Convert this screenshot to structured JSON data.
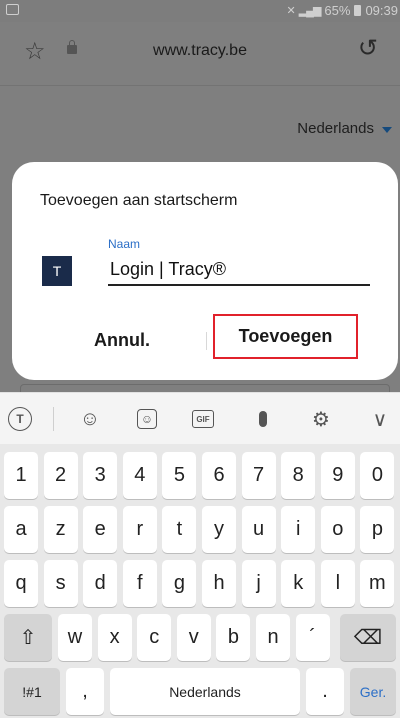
{
  "statusbar": {
    "battery": "65%",
    "time": "09:39"
  },
  "browser": {
    "url": "www.tracy.be"
  },
  "page": {
    "language": "Nederlands"
  },
  "dialog": {
    "title": "Toevoegen aan startscherm",
    "app_icon_letter": "T",
    "field_label": "Naam",
    "field_value": "Login | Tracy®",
    "cancel_label": "Annul.",
    "add_label": "Toevoegen"
  },
  "keyboard": {
    "toolbar": {
      "gif": "GIF"
    },
    "row1": [
      "1",
      "2",
      "3",
      "4",
      "5",
      "6",
      "7",
      "8",
      "9",
      "0"
    ],
    "row2": [
      "a",
      "z",
      "e",
      "r",
      "t",
      "y",
      "u",
      "i",
      "o",
      "p"
    ],
    "row3": [
      "q",
      "s",
      "d",
      "f",
      "g",
      "h",
      "j",
      "k",
      "l",
      "m"
    ],
    "row4": [
      "w",
      "x",
      "c",
      "v",
      "b",
      "n",
      "´"
    ],
    "symbols_label": "!#1",
    "comma_label": ",",
    "space_label": "Nederlands",
    "period_label": ".",
    "enter_label": "Ger.",
    "colors": {
      "enter": "#2c6fc7",
      "highlight": "#e1212b"
    }
  }
}
